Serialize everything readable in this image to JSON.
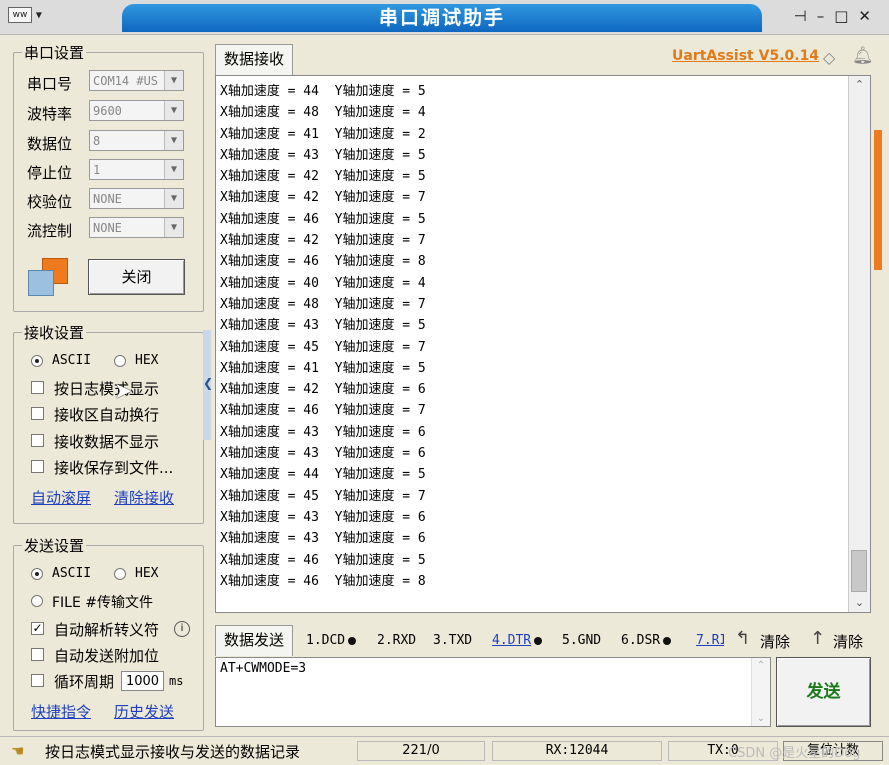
{
  "window": {
    "title": "串口调试助手",
    "menu_logo": "ww",
    "brand": "UartAssist V5.0.14",
    "controls": [
      "pin-icon",
      "minimize-icon",
      "maximize-icon",
      "close-icon"
    ]
  },
  "serial_settings": {
    "title": "串口设置",
    "fields": [
      {
        "label": "串口号",
        "value": "COM14 #US"
      },
      {
        "label": "波特率",
        "value": "9600"
      },
      {
        "label": "数据位",
        "value": "8"
      },
      {
        "label": "停止位",
        "value": "1"
      },
      {
        "label": "校验位",
        "value": "NONE"
      },
      {
        "label": "流控制",
        "value": "NONE"
      }
    ],
    "close_button": "关闭"
  },
  "receive_settings": {
    "title": "接收设置",
    "mode_ascii": "ASCII",
    "mode_hex": "HEX",
    "selected_mode": "ASCII",
    "options": [
      {
        "label": "按日志模式显示",
        "checked": false
      },
      {
        "label": "接收区自动换行",
        "checked": false
      },
      {
        "label": "接收数据不显示",
        "checked": false
      },
      {
        "label": "接收保存到文件...",
        "checked": false
      }
    ],
    "link_auto_scroll": "自动滚屏",
    "link_clear": "清除接收"
  },
  "send_settings": {
    "title": "发送设置",
    "mode_ascii": "ASCII",
    "mode_hex": "HEX",
    "mode_file": "FILE #传输文件",
    "options": [
      {
        "label": "自动解析转义符",
        "checked": true
      },
      {
        "label": "自动发送附加位",
        "checked": false
      },
      {
        "label": "循环周期",
        "checked": false
      }
    ],
    "period_value": "1000",
    "period_unit": "ms",
    "link_shortcuts": "快捷指令",
    "link_history": "历史发送"
  },
  "receive_area": {
    "tab_label": "数据接收",
    "lines": [
      "X轴加速度 = 44  Y轴加速度 = 5",
      "X轴加速度 = 48  Y轴加速度 = 4",
      "X轴加速度 = 41  Y轴加速度 = 2",
      "X轴加速度 = 43  Y轴加速度 = 5",
      "X轴加速度 = 42  Y轴加速度 = 5",
      "X轴加速度 = 42  Y轴加速度 = 7",
      "X轴加速度 = 46  Y轴加速度 = 5",
      "X轴加速度 = 42  Y轴加速度 = 7",
      "X轴加速度 = 46  Y轴加速度 = 8",
      "X轴加速度 = 40  Y轴加速度 = 4",
      "X轴加速度 = 48  Y轴加速度 = 7",
      "X轴加速度 = 43  Y轴加速度 = 5",
      "X轴加速度 = 45  Y轴加速度 = 7",
      "X轴加速度 = 41  Y轴加速度 = 5",
      "X轴加速度 = 42  Y轴加速度 = 6",
      "X轴加速度 = 46  Y轴加速度 = 7",
      "X轴加速度 = 43  Y轴加速度 = 6",
      "X轴加速度 = 43  Y轴加速度 = 6",
      "X轴加速度 = 44  Y轴加速度 = 5",
      "X轴加速度 = 45  Y轴加速度 = 7",
      "X轴加速度 = 43  Y轴加速度 = 6",
      "X轴加速度 = 43  Y轴加速度 = 6",
      "X轴加速度 = 46  Y轴加速度 = 5",
      "X轴加速度 = 46  Y轴加速度 = 8"
    ]
  },
  "send_area": {
    "tab_label": "数据发送",
    "signals": [
      "1.DCD",
      "2.RXD",
      "3.TXD",
      "4.DTR",
      "5.GND",
      "6.DSR",
      "7.RI"
    ],
    "clear1": "清除",
    "clear2": "清除",
    "input_value": "AT+CWMODE=3",
    "send_button": "发送"
  },
  "status_bar": {
    "message": "按日志模式显示接收与发送的数据记录",
    "counter": "221/0",
    "rx": "RX:12044",
    "tx": "TX:0",
    "reset": "复位计数",
    "watermark": "CSDN @是火星的Dog"
  }
}
